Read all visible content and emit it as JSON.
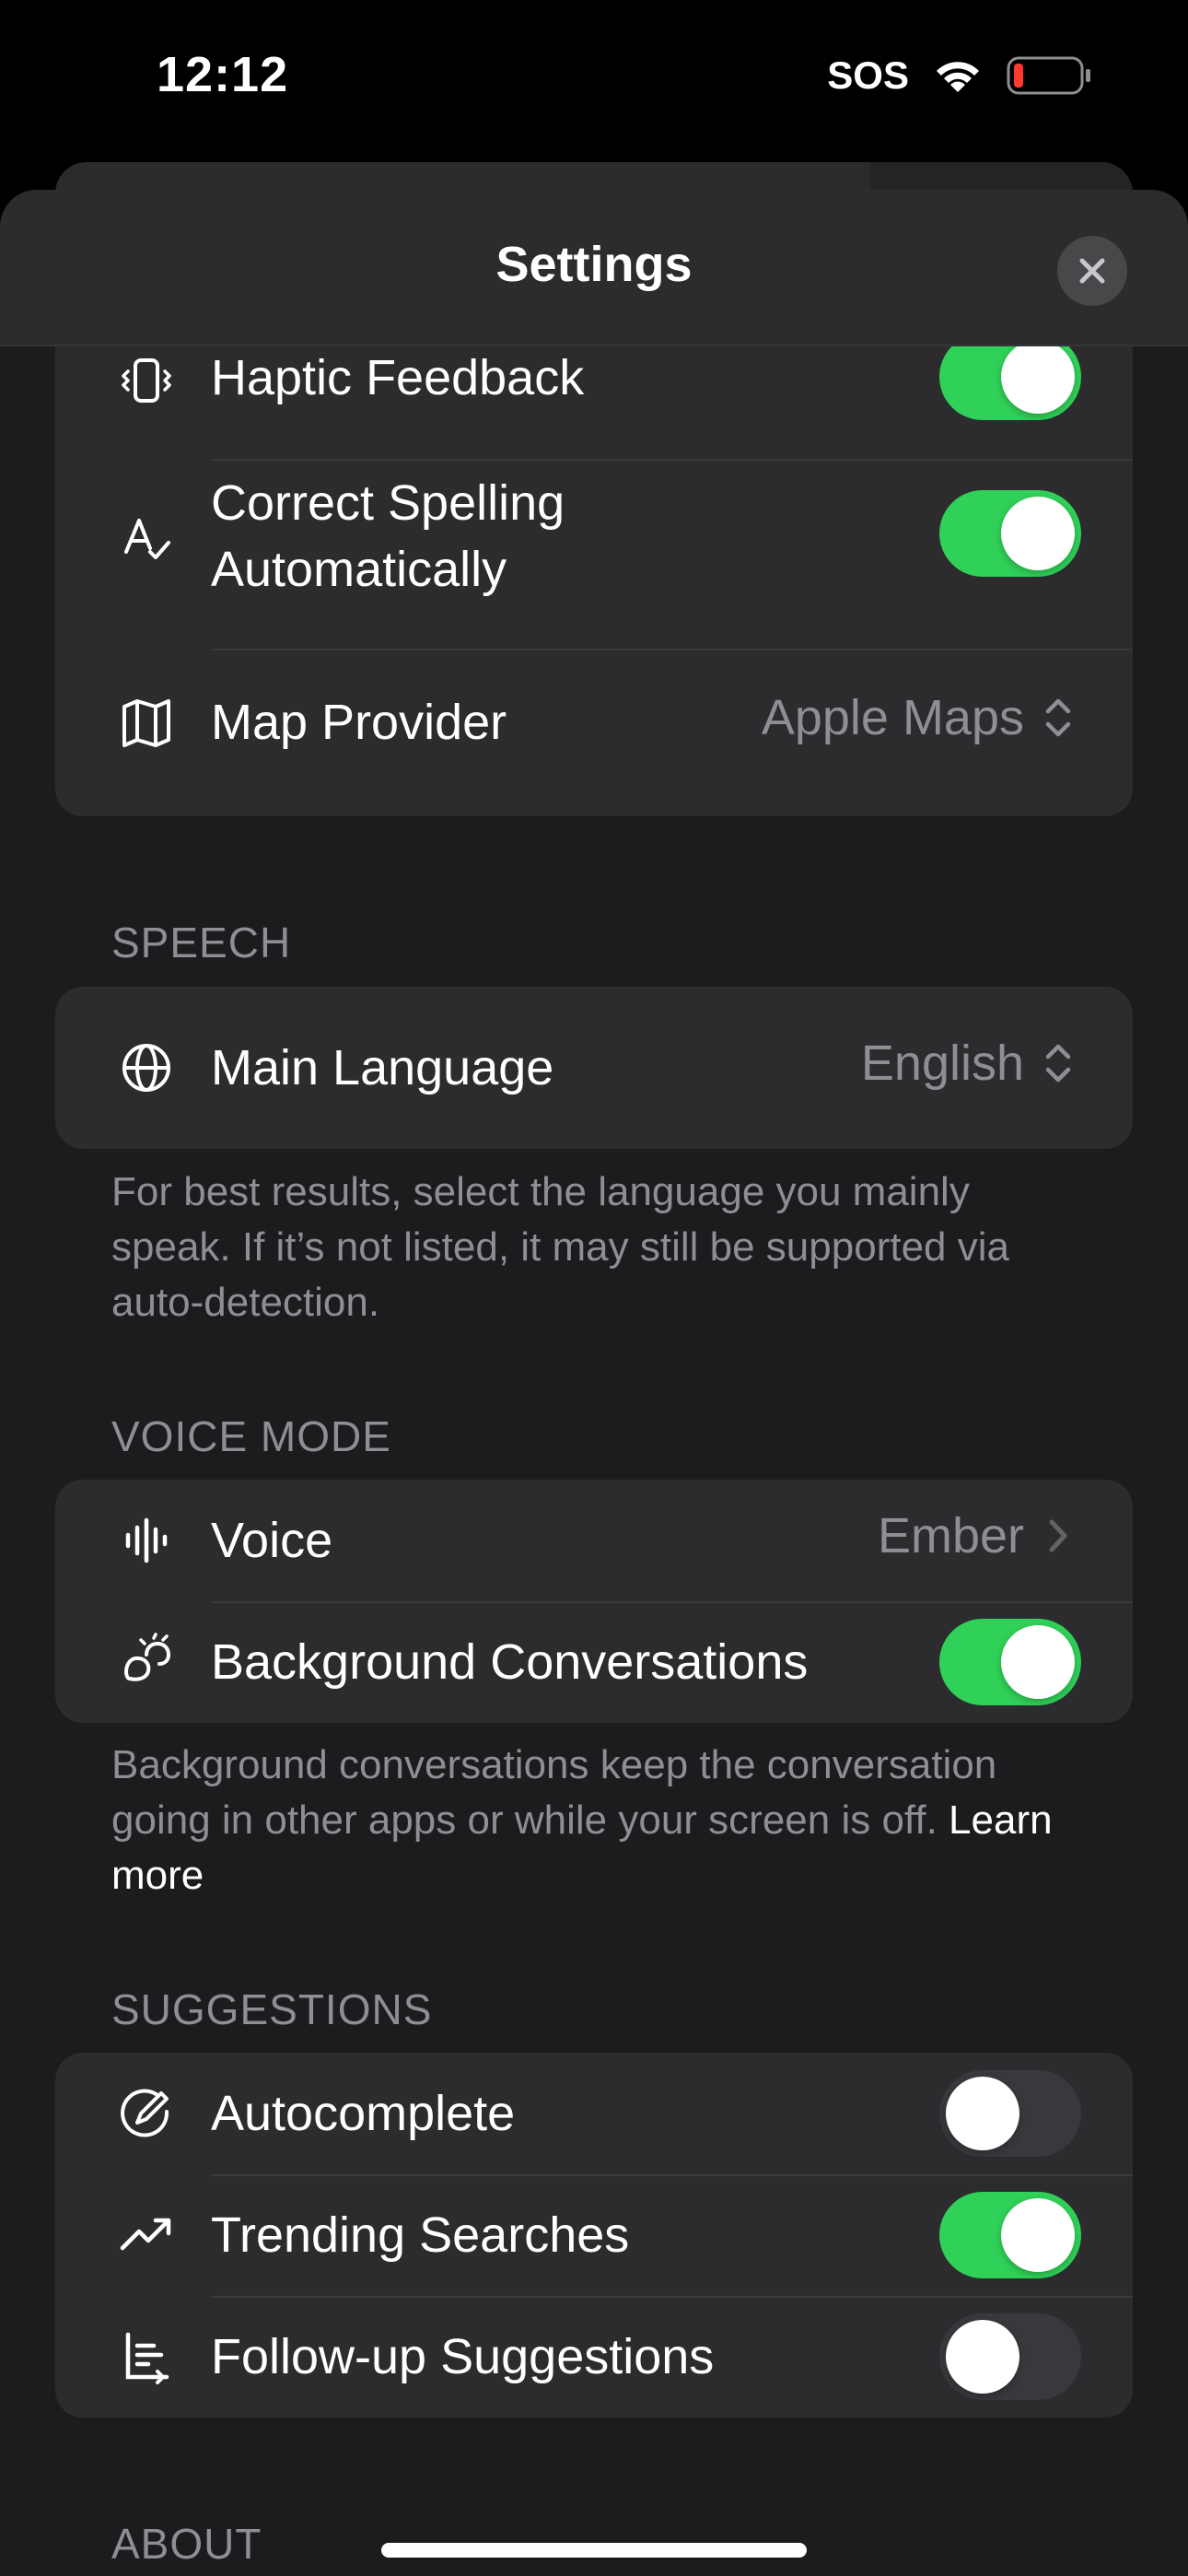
{
  "status_bar": {
    "time": "12:12",
    "carrier": "SOS"
  },
  "nav": {
    "title": "Settings"
  },
  "general": {
    "haptic_feedback": {
      "label": "Haptic Feedback",
      "on": true
    },
    "correct_spelling": {
      "label": "Correct Spelling Automatically",
      "on": true
    },
    "map_provider": {
      "label": "Map Provider",
      "value": "Apple Maps"
    }
  },
  "speech": {
    "header": "SPEECH",
    "main_language": {
      "label": "Main Language",
      "value": "English"
    },
    "footnote": "For best results, select the language you mainly speak. If it’s not listed, it may still be supported via auto-detection."
  },
  "voice_mode": {
    "header": "VOICE MODE",
    "voice": {
      "label": "Voice",
      "value": "Ember"
    },
    "background_conversations": {
      "label": "Background Conversations",
      "on": true
    },
    "footnote": "Background conversations keep the conversation going in other apps or while your screen is off.",
    "learn_more": "Learn more"
  },
  "suggestions": {
    "header": "SUGGESTIONS",
    "autocomplete": {
      "label": "Autocomplete",
      "on": false
    },
    "trending_searches": {
      "label": "Trending Searches",
      "on": true
    },
    "follow_up": {
      "label": "Follow-up Suggestions",
      "on": false
    }
  },
  "about": {
    "header": "ABOUT"
  },
  "colors": {
    "toggle_on": "#30d158",
    "toggle_off": "#39393d",
    "background": "#1c1c1e",
    "card": "#2c2c2e"
  }
}
